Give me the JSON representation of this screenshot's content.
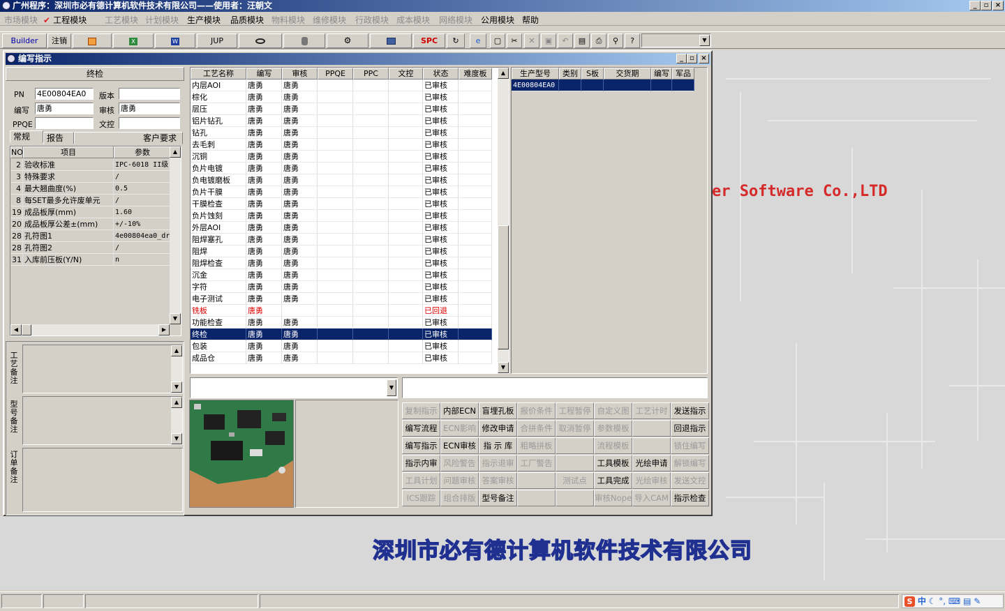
{
  "window": {
    "title": "广州程序：深圳市必有德计算机软件技术有限公司——使用者：汪朝文"
  },
  "menu": [
    {
      "label": "市场模块",
      "enabled": false
    },
    {
      "label": "工程模块",
      "enabled": true,
      "checked": true
    },
    {
      "label": "工艺模块",
      "enabled": false
    },
    {
      "label": "计划模块",
      "enabled": false
    },
    {
      "label": "生产模块",
      "enabled": true
    },
    {
      "label": "品质模块",
      "enabled": true
    },
    {
      "label": "物料模块",
      "enabled": false
    },
    {
      "label": "维修模块",
      "enabled": false
    },
    {
      "label": "行政模块",
      "enabled": false
    },
    {
      "label": "成本模块",
      "enabled": false
    },
    {
      "label": "网络模块",
      "enabled": false
    },
    {
      "label": "公用模块",
      "enabled": true
    },
    {
      "label": "帮助",
      "enabled": true
    }
  ],
  "toolbar": {
    "builder": "Builder",
    "logout": "注销",
    "jup": "JUP",
    "spc": "SPC",
    "icons": [
      "powerpoint-icon",
      "excel-icon",
      "word-icon",
      "eye-icon",
      "database-icon",
      "network-icon",
      "computer-icon",
      "export-icon",
      "ie-icon",
      "new-doc-icon",
      "cut-icon",
      "delete-icon",
      "save-icon",
      "undo-icon",
      "preview-icon",
      "print-icon",
      "find-icon",
      "help-icon"
    ]
  },
  "child": {
    "title": "编写指示"
  },
  "left": {
    "process_name": "终检",
    "pn_label": "PN",
    "pn_value": "4E00804EA0",
    "version_label": "版本",
    "version_value": "",
    "writer_label": "编写",
    "writer_value": "唐勇",
    "auditor_label": "审核",
    "auditor_value": "唐勇",
    "ppqe_label": "PPQE",
    "ppqe_value": "",
    "doc_label": "文控",
    "doc_value": "",
    "tabs": [
      "常规",
      "报告",
      "客户要求"
    ],
    "param_headers": [
      "NO",
      "项目",
      "参数"
    ],
    "params": [
      {
        "no": "2",
        "item": "验收标准",
        "value": "IPC-6018 II级"
      },
      {
        "no": "3",
        "item": "特殊要求",
        "value": "/"
      },
      {
        "no": "4",
        "item": "最大翘曲度(%)",
        "value": "0.5"
      },
      {
        "no": "8",
        "item": "每SET最多允许废单元",
        "value": "/"
      },
      {
        "no": "19",
        "item": "成品板厚(mm)",
        "value": "1.60"
      },
      {
        "no": "20",
        "item": "成品板厚公差±(mm)",
        "value": "+/-10%"
      },
      {
        "no": "28",
        "item": "孔符图1",
        "value": "4e00804ea0_dr"
      },
      {
        "no": "28",
        "item": "孔符图2",
        "value": "/"
      },
      {
        "no": "31",
        "item": "入库前压板(Y/N)",
        "value": "n"
      }
    ],
    "notes": [
      "工艺备注",
      "型号备注",
      "订单备注"
    ]
  },
  "process": {
    "headers": [
      "工艺名称",
      "编写",
      "审核",
      "PPQE",
      "PPC",
      "文控",
      "状态",
      "难度板"
    ],
    "rows": [
      {
        "name": "内层AOI",
        "writer": "唐勇",
        "auditor": "唐勇",
        "status": "已审核"
      },
      {
        "name": "棕化",
        "writer": "唐勇",
        "auditor": "唐勇",
        "status": "已审核"
      },
      {
        "name": "层压",
        "writer": "唐勇",
        "auditor": "唐勇",
        "status": "已审核"
      },
      {
        "name": "铝片钻孔",
        "writer": "唐勇",
        "auditor": "唐勇",
        "status": "已审核"
      },
      {
        "name": "钻孔",
        "writer": "唐勇",
        "auditor": "唐勇",
        "status": "已审核"
      },
      {
        "name": "去毛刺",
        "writer": "唐勇",
        "auditor": "唐勇",
        "status": "已审核"
      },
      {
        "name": "沉铜",
        "writer": "唐勇",
        "auditor": "唐勇",
        "status": "已审核"
      },
      {
        "name": "负片电镀",
        "writer": "唐勇",
        "auditor": "唐勇",
        "status": "已审核"
      },
      {
        "name": "负电镀磨板",
        "writer": "唐勇",
        "auditor": "唐勇",
        "status": "已审核"
      },
      {
        "name": "负片干膜",
        "writer": "唐勇",
        "auditor": "唐勇",
        "status": "已审核"
      },
      {
        "name": "干膜检查",
        "writer": "唐勇",
        "auditor": "唐勇",
        "status": "已审核"
      },
      {
        "name": "负片蚀刻",
        "writer": "唐勇",
        "auditor": "唐勇",
        "status": "已审核"
      },
      {
        "name": "外层AOI",
        "writer": "唐勇",
        "auditor": "唐勇",
        "status": "已审核"
      },
      {
        "name": "阻焊塞孔",
        "writer": "唐勇",
        "auditor": "唐勇",
        "status": "已审核"
      },
      {
        "name": "阻焊",
        "writer": "唐勇",
        "auditor": "唐勇",
        "status": "已审核"
      },
      {
        "name": "阻焊检查",
        "writer": "唐勇",
        "auditor": "唐勇",
        "status": "已审核"
      },
      {
        "name": "沉金",
        "writer": "唐勇",
        "auditor": "唐勇",
        "status": "已审核"
      },
      {
        "name": "字符",
        "writer": "唐勇",
        "auditor": "唐勇",
        "status": "已审核"
      },
      {
        "name": "电子测试",
        "writer": "唐勇",
        "auditor": "唐勇",
        "status": "已审核"
      },
      {
        "name": "铣板",
        "writer": "唐勇",
        "auditor": "",
        "status": "已回退",
        "red": true
      },
      {
        "name": "功能检查",
        "writer": "唐勇",
        "auditor": "唐勇",
        "status": "已审核"
      },
      {
        "name": "终检",
        "writer": "唐勇",
        "auditor": "唐勇",
        "status": "已审核",
        "selected": true
      },
      {
        "name": "包装",
        "writer": "唐勇",
        "auditor": "唐勇",
        "status": "已审核"
      },
      {
        "name": "成品仓",
        "writer": "唐勇",
        "auditor": "唐勇",
        "status": "已审核"
      }
    ]
  },
  "models": {
    "headers": [
      "生产型号",
      "类别",
      "S板",
      "交货期",
      "编写",
      "军品"
    ],
    "rows": [
      {
        "model": "4E00804EA0",
        "selected": true
      }
    ]
  },
  "actions": [
    [
      "复制指示",
      "内部ECN",
      "盲埋孔板",
      "报价条件",
      "工程暂停",
      "自定义图",
      "工艺计时",
      "发送指示"
    ],
    [
      "编写流程",
      "ECN影响",
      "修改申请",
      "合拼条件",
      "取消暂停",
      "参数模板",
      "",
      "回退指示"
    ],
    [
      "编写指示",
      "ECN审核",
      "指 示 库",
      "粗略拼板",
      "",
      "流程模板",
      "",
      "锁住编写"
    ],
    [
      "指示内审",
      "风险警告",
      "指示退审",
      "工厂警告",
      "",
      "工具模板",
      "光绘申请",
      "解锁编写"
    ],
    [
      "工具计划",
      "问题审核",
      "答案审核",
      "",
      "测试点",
      "工具完成",
      "光绘审核",
      "发送文控"
    ],
    [
      "ICS跟踪",
      "组合排版",
      "型号备注",
      "",
      "",
      "审核Nope",
      "导入CAM",
      "指示检查"
    ]
  ],
  "actions_enabled": [
    [
      false,
      true,
      true,
      false,
      false,
      false,
      false,
      true
    ],
    [
      true,
      false,
      true,
      false,
      false,
      false,
      false,
      true
    ],
    [
      true,
      true,
      true,
      false,
      false,
      false,
      false,
      false
    ],
    [
      true,
      false,
      false,
      false,
      false,
      true,
      true,
      false
    ],
    [
      false,
      false,
      false,
      false,
      false,
      true,
      false,
      false
    ],
    [
      false,
      false,
      true,
      false,
      false,
      false,
      false,
      true
    ]
  ],
  "desktop": {
    "watermark": "er Software Co.,LTD",
    "company": "深圳市必有德计算机软件技术有限公司"
  },
  "tray": {
    "ime": "中"
  },
  "colors": {
    "selection": "#0a246a",
    "rejected": "#e00000",
    "accent_red": "#d62a2a",
    "company_blue": "#8590ff"
  }
}
